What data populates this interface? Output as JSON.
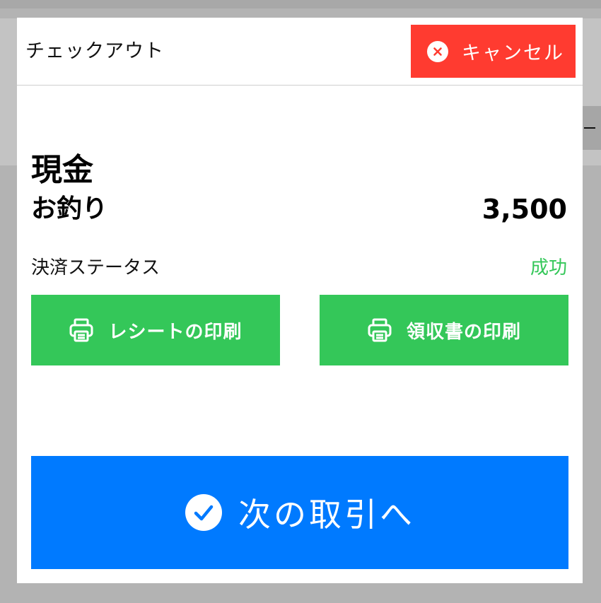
{
  "modal": {
    "title": "チェックアウト",
    "cancel_label": "キャンセル",
    "cancel_icon": "close-circle-icon"
  },
  "payment": {
    "method": "現金",
    "change_label": "お釣り",
    "change_amount": "3,500",
    "status_label": "決済ステータス",
    "status_value": "成功"
  },
  "actions": {
    "print_receipt_label": "レシートの印刷",
    "print_invoice_label": "領収書の印刷",
    "print_icon": "printer-icon",
    "next_label": "次の取引へ",
    "next_icon": "check-circle-icon"
  },
  "colors": {
    "cancel": "#ff3b30",
    "success": "#34c759",
    "primary": "#007aff",
    "overlay": "#b3b3b3"
  }
}
